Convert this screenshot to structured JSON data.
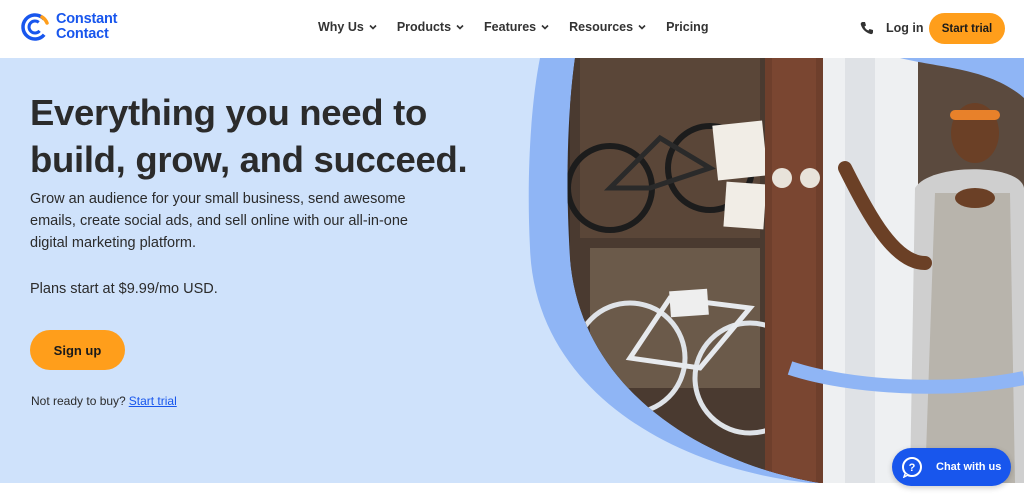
{
  "brand": {
    "name_line1": "Constant",
    "name_line2": "Contact",
    "accent": "#1856ed",
    "cta_color": "#ff9e1b",
    "hero_bg": "#cfe2fb"
  },
  "nav": {
    "items": [
      {
        "label": "Why Us",
        "icon": "chevron-down-icon"
      },
      {
        "label": "Products",
        "icon": "chevron-down-icon"
      },
      {
        "label": "Features",
        "icon": "chevron-down-icon"
      },
      {
        "label": "Resources",
        "icon": "chevron-down-icon"
      },
      {
        "label": "Pricing"
      }
    ],
    "phone_icon": "phone-icon",
    "login_label": "Log in",
    "start_trial_label": "Start trial"
  },
  "hero": {
    "headline_line1": "Everything you need to",
    "headline_line2": "build, grow, and succeed.",
    "subtext": "Grow an audience for your small business, send awesome emails, create social ads, and sell online with our all-in-one digital marketing platform.",
    "plans": "Plans start at $9.99/mo USD.",
    "signup_label": "Sign up",
    "not_ready_text": "Not ready to buy?",
    "not_ready_link": "Start trial",
    "image": "bike-shop-owner-photo"
  },
  "chat": {
    "label": "Chat with us",
    "icon": "chat-question-icon"
  }
}
